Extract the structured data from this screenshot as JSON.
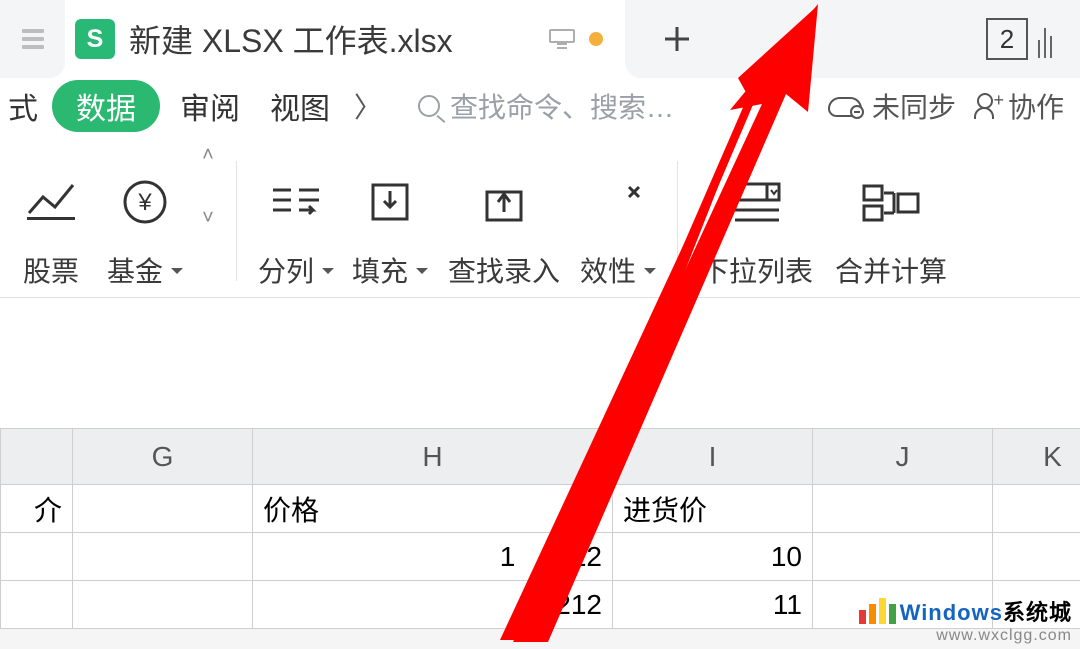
{
  "titlebar": {
    "filetype_badge": "S",
    "filename": "新建 XLSX 工作表.xlsx",
    "window_count": "2"
  },
  "menubar": {
    "formula_fragment": "式",
    "data": "数据",
    "review": "审阅",
    "view": "视图",
    "more": "〉",
    "search_placeholder": "查找命令、搜索…",
    "sync_label": "未同步",
    "collab_label": "协作"
  },
  "ribbon": {
    "stock": "股票",
    "fund": "基金",
    "split": "分列",
    "fill": "填充",
    "find_input": "查找录入",
    "validity_fragment": "效性",
    "dropdown_list": "下拉列表",
    "merge_calc": "合并计算"
  },
  "sheet": {
    "headers": {
      "G": "G",
      "H": "H",
      "I": "I",
      "J": "J",
      "K": "K"
    },
    "rows": [
      {
        "F_fragment": "介",
        "H": "价格",
        "I": "进货价"
      },
      {
        "H_fragment_left": "1",
        "H_fragment_right": "212",
        "I": "10"
      },
      {
        "H_fragment": ".212",
        "I": "11"
      }
    ]
  },
  "watermark": {
    "title_a": "Windows",
    "title_b": "系统城",
    "sub": "www.wxclgg.com"
  }
}
